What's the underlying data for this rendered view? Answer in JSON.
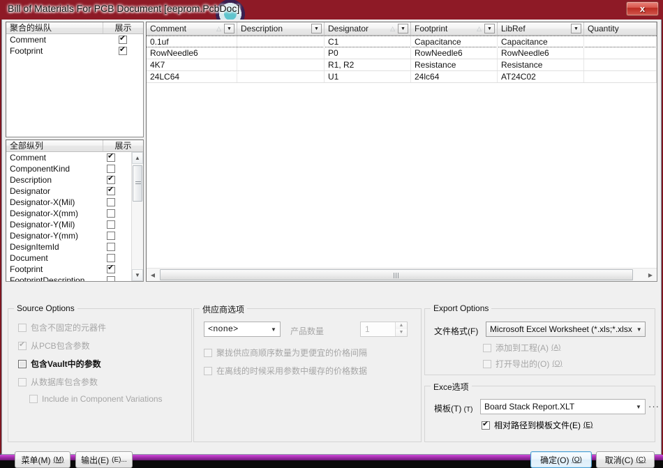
{
  "window": {
    "title": "Bill of Materials For PCB Document [eeprom.PcbDoc]",
    "close_label": "x"
  },
  "aggregated_columns": {
    "header_name": "聚合的纵队",
    "header_show": "展示",
    "items": [
      {
        "label": "Comment",
        "checked": true
      },
      {
        "label": "Footprint",
        "checked": true
      }
    ]
  },
  "all_columns": {
    "header_name": "全部纵列",
    "header_show": "展示",
    "items": [
      {
        "label": "Comment",
        "checked": true
      },
      {
        "label": "ComponentKind",
        "checked": false
      },
      {
        "label": "Description",
        "checked": true
      },
      {
        "label": "Designator",
        "checked": true
      },
      {
        "label": "Designator-X(Mil)",
        "checked": false
      },
      {
        "label": "Designator-X(mm)",
        "checked": false
      },
      {
        "label": "Designator-Y(Mil)",
        "checked": false
      },
      {
        "label": "Designator-Y(mm)",
        "checked": false
      },
      {
        "label": "DesignItemId",
        "checked": false
      },
      {
        "label": "Document",
        "checked": false
      },
      {
        "label": "Footprint",
        "checked": true
      },
      {
        "label": "FootprintDescription",
        "checked": false
      }
    ]
  },
  "grid": {
    "columns": [
      {
        "label": "Comment",
        "width": 130,
        "sort": true,
        "dropdown": true
      },
      {
        "label": "Description",
        "width": 125,
        "sort": false,
        "dropdown": true
      },
      {
        "label": "Designator",
        "width": 124,
        "sort": true,
        "dropdown": true
      },
      {
        "label": "Footprint",
        "width": 124,
        "sort": true,
        "dropdown": true
      },
      {
        "label": "LibRef",
        "width": 124,
        "sort": false,
        "dropdown": true
      },
      {
        "label": "Quantity",
        "width": 104,
        "sort": false,
        "dropdown": false
      }
    ],
    "rows": [
      [
        "0.1uf",
        "",
        "C1",
        "Capacitance",
        "Capacitance",
        ""
      ],
      [
        "RowNeedle6",
        "",
        "P0",
        "RowNeedle6",
        "RowNeedle6",
        ""
      ],
      [
        "4K7",
        "",
        "R1, R2",
        "Resistance",
        "Resistance",
        ""
      ],
      [
        "24LC64",
        "",
        "U1",
        "24lc64",
        "AT24C02",
        ""
      ]
    ]
  },
  "source_options": {
    "caption": "Source Options",
    "items": [
      {
        "label": "包含不固定的元器件",
        "checked": false,
        "state": "dim"
      },
      {
        "label": "从PCB包含参数",
        "checked": true,
        "state": "dim"
      },
      {
        "label": "包含Vault中的参数",
        "checked": false,
        "state": "strong"
      },
      {
        "label": "从数据库包含参数",
        "checked": false,
        "state": "dim"
      },
      {
        "label": "Include in Component Variations",
        "checked": false,
        "state": "dim"
      }
    ]
  },
  "supplier_options": {
    "caption": "供应商选项",
    "supplier_value": "<none>",
    "quantity_label": "产品数量",
    "quantity_value": "1",
    "checks": [
      {
        "label": "聚拢供应商顺序数量为更便宜的价格间隔",
        "checked": false
      },
      {
        "label": "在离线的时候采用参数中缓存的价格数据",
        "checked": false
      }
    ]
  },
  "export_options": {
    "caption": "Export Options",
    "format_label": "文件格式(F)",
    "format_value": "Microsoft Excel Worksheet (*.xls;*.xlsx;*.x",
    "checks": [
      {
        "label": "添加到工程(A)",
        "mnemonic": "(A)",
        "checked": false
      },
      {
        "label": "打开导出的(O)",
        "mnemonic": "(O)",
        "checked": false
      }
    ]
  },
  "excel_options": {
    "caption": "Exce选项",
    "template_label": "模板(T)",
    "template_mnemonic": "(T)",
    "template_value": "Board Stack Report.XLT",
    "browse_label": "···",
    "relative_path": {
      "label": "相对路径到模板文件(E)",
      "mnemonic": "(E)",
      "checked": true
    }
  },
  "footer": {
    "menu_label": "菜单(M)",
    "menu_mnemonic": "(M)",
    "export_label": "输出(E)",
    "export_mnemonic": "(E)...",
    "ok_label": "确定(O)",
    "ok_mnemonic": "(O)",
    "cancel_label": "取消(C)",
    "cancel_mnemonic": "(C)"
  }
}
